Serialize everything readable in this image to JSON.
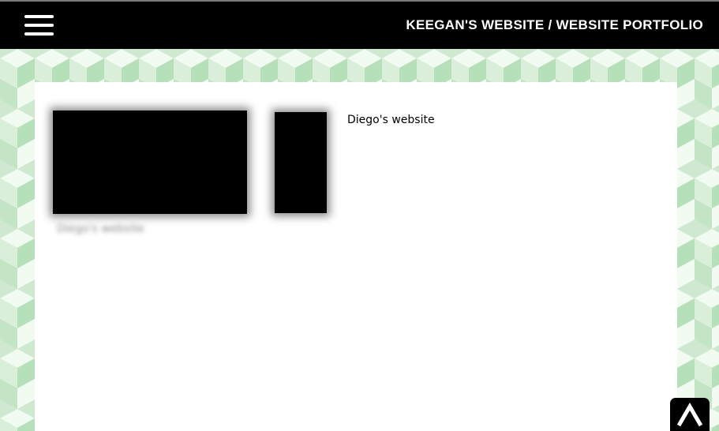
{
  "header": {
    "title": "KEEGAN'S WEBSITE / WEBSITE PORTFOLIO",
    "menu_icon": "hamburger-menu-icon"
  },
  "portfolio": {
    "items": [
      {
        "caption": "Diego's website",
        "link_text": "Diego's website"
      }
    ]
  },
  "footer": {
    "back_to_top_icon": "chevron-up-icon"
  },
  "colors": {
    "header_bg": "#000000",
    "pattern_light": "#f2fbf2",
    "pattern_mid": "#cfe9d0",
    "pattern_dark": "#b6e0b9",
    "panel_bg": "#ffffff"
  }
}
